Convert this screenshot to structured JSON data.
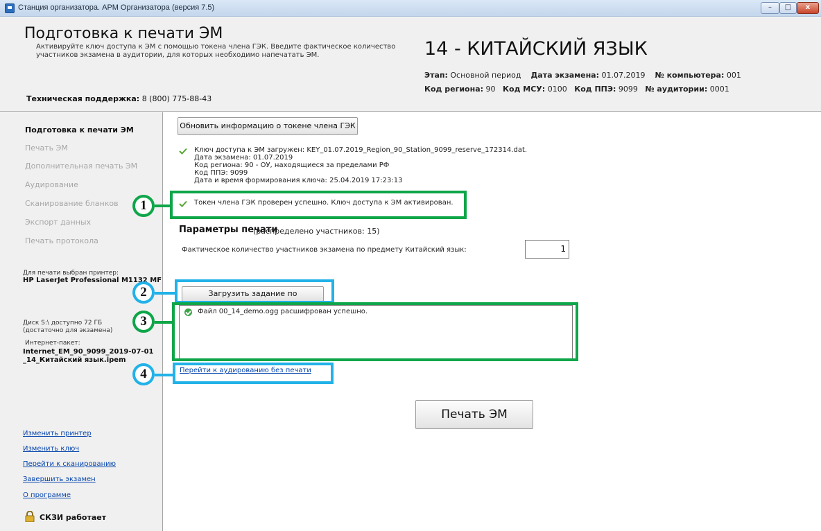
{
  "window": {
    "title": "Станция организатора. АРМ Организатора (версия 7.5)",
    "min_glyph": "–",
    "max_glyph": "□",
    "close_glyph": "x"
  },
  "header": {
    "title": "Подготовка к печати ЭМ",
    "subtitle": "Активируйте ключ доступа к ЭМ с помощью токена члена ГЭК. Введите фактическое количество участников экзамена в аудитории, для которых необходимо напечатать ЭМ.",
    "support_label": "Техническая поддержка:",
    "support_phone": "8 (800) 775-88-43",
    "subject": "14 - КИТАЙСКИЙ ЯЗЫК",
    "stage_label": "Этап:",
    "stage_value": "Основной период",
    "exam_date_label": "Дата экзамена:",
    "exam_date_value": "01.07.2019",
    "computer_label": "№ компьютера:",
    "computer_value": "001",
    "region_label": "Код региона:",
    "region_value": "90",
    "msu_label": "Код МСУ:",
    "msu_value": "0100",
    "ppe_label": "Код ППЭ:",
    "ppe_value": "9099",
    "auditorium_label": "№ аудитории:",
    "auditorium_value": "0001"
  },
  "sidebar": {
    "items": [
      {
        "label": "Подготовка к печати ЭМ"
      },
      {
        "label": "Печать ЭМ"
      },
      {
        "label": "Дополнительная печать ЭМ"
      },
      {
        "label": "Аудирование"
      },
      {
        "label": "Сканирование бланков"
      },
      {
        "label": "Экспорт данных"
      },
      {
        "label": "Печать протокола"
      }
    ],
    "printer_label": "Для печати выбран принтер:",
    "printer_name": "HP LaserJet Professional M1132 MFP",
    "disk_line1": "Диск S:\\ доступно 72 ГБ",
    "disk_line2": "(достаточно для экзамена)",
    "package_label": "Интернет-пакет:",
    "package_line1": "Internet_EM_90_9099_2019-07-01",
    "package_line2": "_14_Китайский язык.ipem",
    "links": [
      {
        "label": "Изменить принтер"
      },
      {
        "label": "Изменить ключ"
      },
      {
        "label": "Перейти к сканированию"
      },
      {
        "label": "Завершить экзамен"
      },
      {
        "label": "О программе"
      }
    ],
    "crypto_status": "СКЗИ работает"
  },
  "main": {
    "refresh_button": "Обновить информацию о токене члена ГЭК",
    "key_lines": [
      "Ключ доступа к ЭМ загружен: KEY_01.07.2019_Region_90_Station_9099_reserve_172314.dat.",
      "Дата экзамена: 01.07.2019",
      "Код региона: 90 - ОУ, находящиеся за пределами РФ",
      "Код ППЭ: 9099",
      "Дата и время формирования ключа: 25.04.2019 17:23:13"
    ],
    "token_status": "Токен члена ГЭК проверен успешно. Ключ доступа к ЭМ активирован.",
    "print_params_title": "Параметры печати",
    "print_params_note": "(распределено участников: 15)",
    "count_label": "Фактическое количество участников экзамена по предмету Китайский язык:",
    "count_value": "1",
    "load_audio_button": "Загрузить задание по аудированию",
    "log_message": "Файл 00_14_demo.ogg расшифрован успешно.",
    "audio_link": "Перейти к аудированию без печати",
    "print_button": "Печать ЭМ"
  },
  "callouts": [
    {
      "number": "1",
      "color": "#0ea649"
    },
    {
      "number": "2",
      "color": "#22b2e8"
    },
    {
      "number": "3",
      "color": "#0ea649"
    },
    {
      "number": "4",
      "color": "#22b2e8"
    }
  ]
}
